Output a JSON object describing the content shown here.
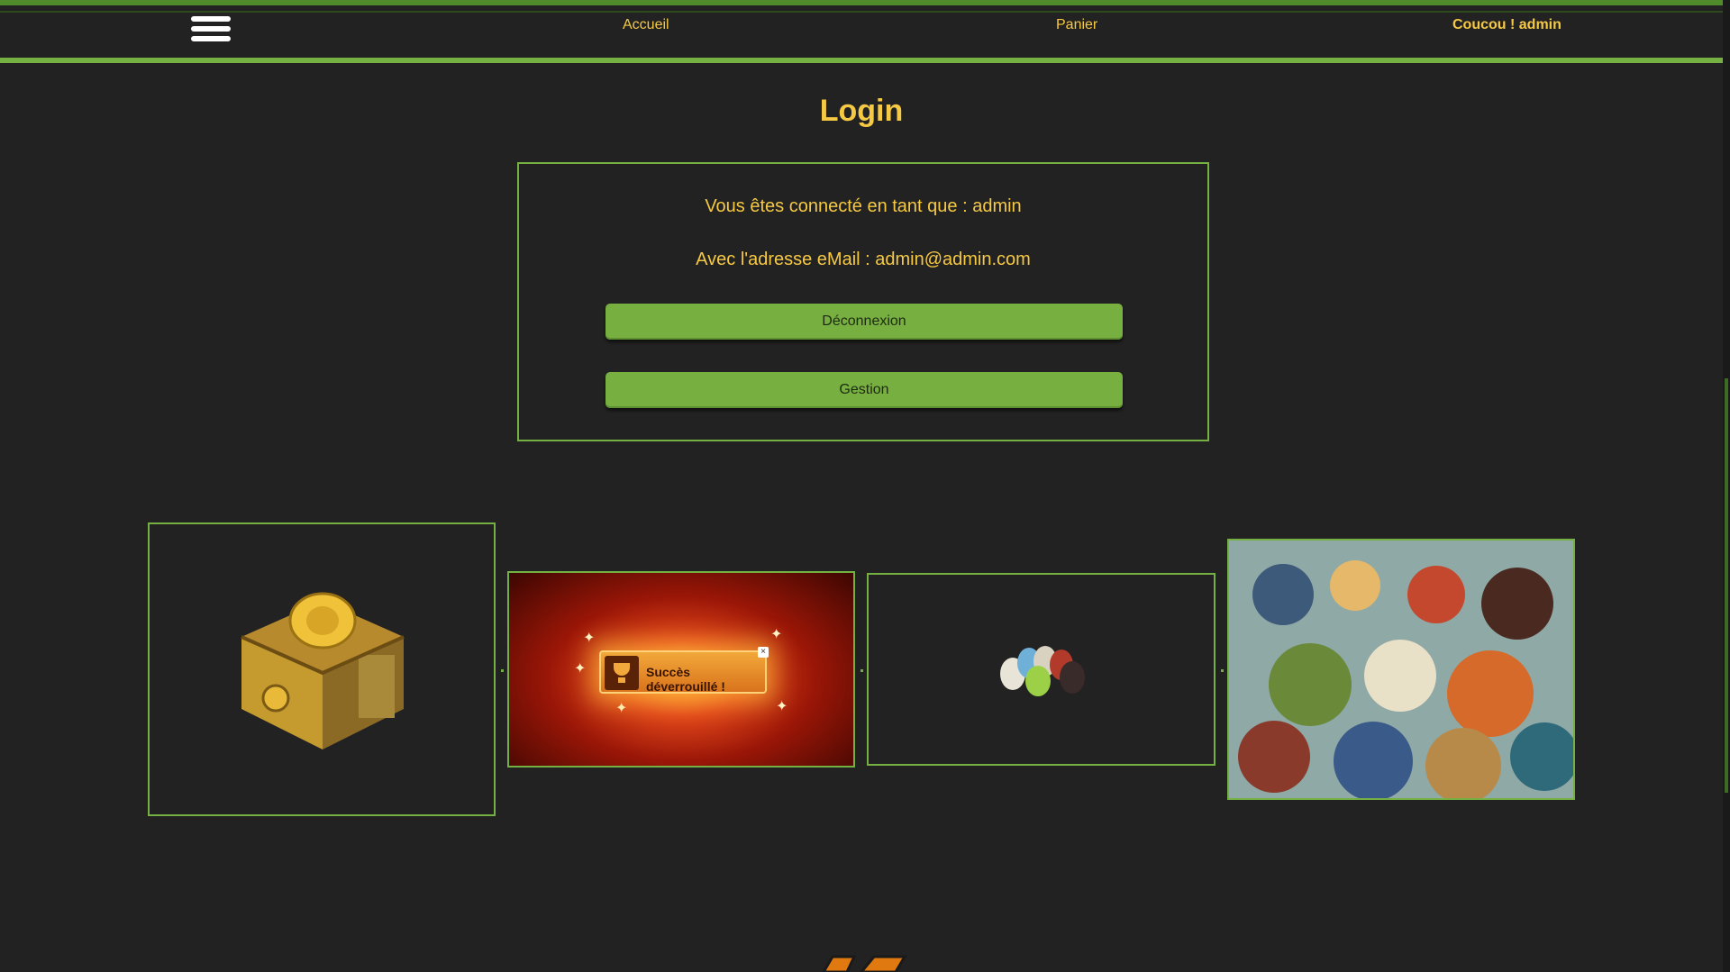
{
  "nav": {
    "links": [
      {
        "label": "Accueil"
      },
      {
        "label": "Panier"
      }
    ],
    "greeting": "Coucou ! admin"
  },
  "page": {
    "title": "Login"
  },
  "login": {
    "connected_as": "Vous êtes connecté en tant que : admin",
    "email_line": "Avec l'adresse eMail : admin@admin.com",
    "logout_label": "Déconnexion",
    "manage_label": "Gestion"
  },
  "gallery": {
    "success_badge_text": "Succès déverrouillé !"
  },
  "colors": {
    "accent_green": "#75b043",
    "text_gold": "#f6c944",
    "background": "#222222"
  },
  "icons": [
    "hamburger-menu-icon",
    "trophy-icon",
    "close-icon"
  ]
}
